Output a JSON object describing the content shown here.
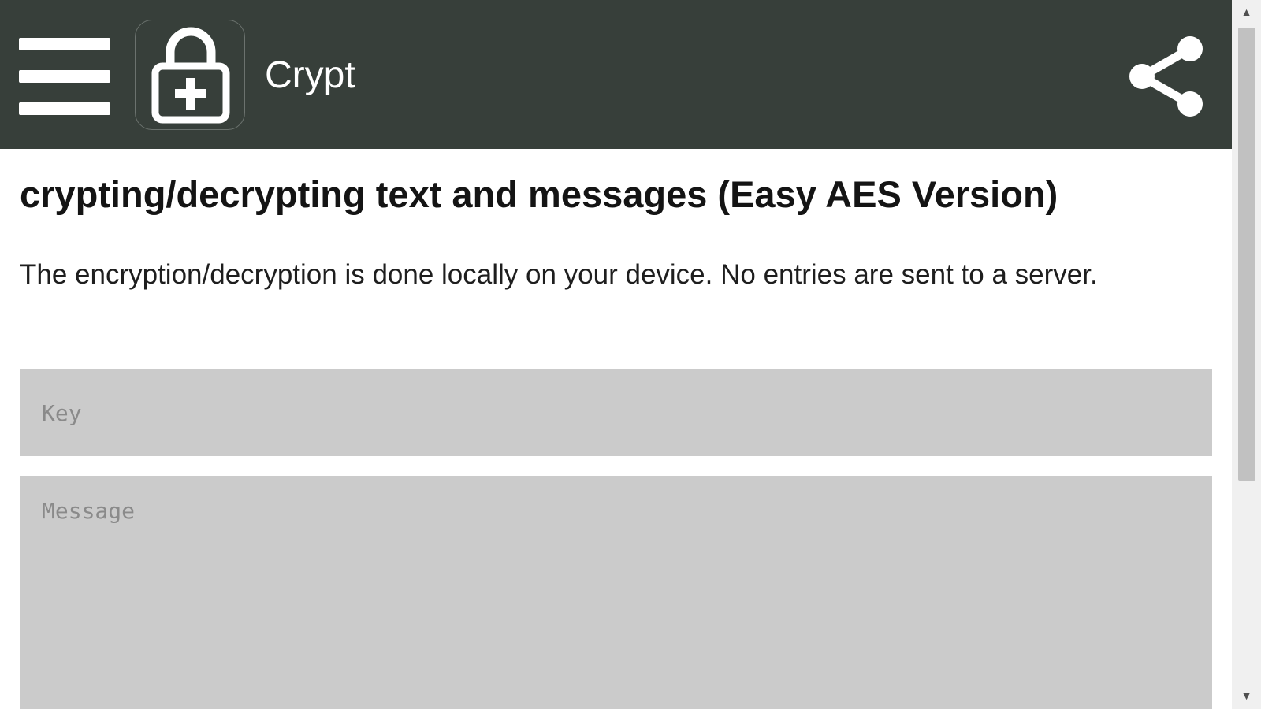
{
  "header": {
    "app_title": "Crypt",
    "background_color": "#373f3a",
    "menu_icon": "hamburger-menu-icon",
    "logo_icon": "lock-plus-icon",
    "share_icon": "share-icon"
  },
  "main": {
    "heading": "crypting/decrypting text and messages (Easy AES Version)",
    "description": "The encryption/decryption is done locally on your device. No entries are sent to a server.",
    "key_field": {
      "value": "",
      "placeholder": "Key"
    },
    "message_field": {
      "value": "",
      "placeholder": "Message"
    },
    "field_background": "#cbcbcb"
  },
  "scrollbar": {
    "up_arrow": "▲",
    "down_arrow": "▼"
  }
}
